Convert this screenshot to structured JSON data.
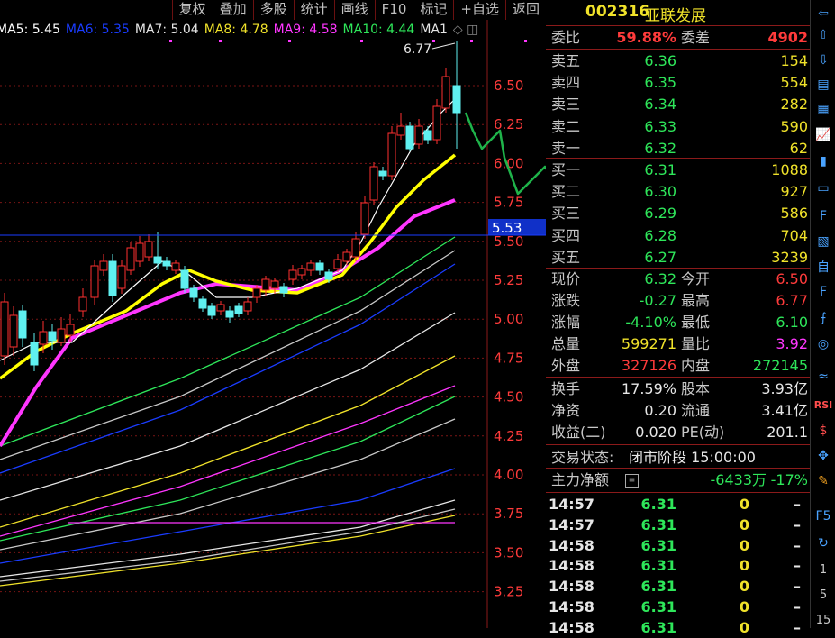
{
  "toolbar": [
    "复权",
    "叠加",
    "多股",
    "统计",
    "画线",
    "F10",
    "标记",
    "+自选",
    "返回"
  ],
  "ma_legend": [
    {
      "text": "MA5: 5.45",
      "color": "#ffffff"
    },
    {
      "text": "MA6: 5.35",
      "color": "#1a3cff"
    },
    {
      "text": "MA7: 5.04",
      "color": "#e6e6e6"
    },
    {
      "text": "MA8: 4.78",
      "color": "#f0e22a"
    },
    {
      "text": "MA9: 4.58",
      "color": "#ff36ff"
    },
    {
      "text": "MA10: 4.44",
      "color": "#2ee65a"
    },
    {
      "text": "MA1",
      "color": "#e6e6e6"
    }
  ],
  "chart": {
    "high_label": "6.77",
    "current_price_tag": "5.53",
    "y_ticks": [
      "6.50",
      "6.25",
      "6.00",
      "5.75",
      "5.50",
      "5.25",
      "5.00",
      "4.75",
      "4.50",
      "4.25",
      "4.00",
      "3.75",
      "3.50",
      "3.25"
    ],
    "y_tick_values": [
      6.5,
      6.25,
      6.0,
      5.75,
      5.5,
      5.25,
      5.0,
      4.75,
      4.5,
      4.25,
      4.0,
      3.75,
      3.5,
      3.25
    ]
  },
  "stock": {
    "code": "002316",
    "name": "亚联发展"
  },
  "weibi": {
    "label1": "委比",
    "value1": "59.88%",
    "label2": "委差",
    "value2": "4902"
  },
  "asks": [
    {
      "label": "卖五",
      "price": "6.36",
      "vol": "154"
    },
    {
      "label": "卖四",
      "price": "6.35",
      "vol": "554"
    },
    {
      "label": "卖三",
      "price": "6.34",
      "vol": "282"
    },
    {
      "label": "卖二",
      "price": "6.33",
      "vol": "590"
    },
    {
      "label": "卖一",
      "price": "6.32",
      "vol": "62"
    }
  ],
  "bids": [
    {
      "label": "买一",
      "price": "6.31",
      "vol": "1088"
    },
    {
      "label": "买二",
      "price": "6.30",
      "vol": "927"
    },
    {
      "label": "买三",
      "price": "6.29",
      "vol": "586"
    },
    {
      "label": "买四",
      "price": "6.28",
      "vol": "704"
    },
    {
      "label": "买五",
      "price": "6.27",
      "vol": "3239"
    }
  ],
  "quote": [
    {
      "l1": "现价",
      "v1": "6.32",
      "c1": "green",
      "l2": "今开",
      "v2": "6.50",
      "c2": "red"
    },
    {
      "l1": "涨跌",
      "v1": "-0.27",
      "c1": "green",
      "l2": "最高",
      "v2": "6.77",
      "c2": "red"
    },
    {
      "l1": "涨幅",
      "v1": "-4.10%",
      "c1": "green",
      "l2": "最低",
      "v2": "6.10",
      "c2": "green"
    },
    {
      "l1": "总量",
      "v1": "599271",
      "c1": "yellow",
      "l2": "量比",
      "v2": "3.92",
      "c2": "magenta"
    },
    {
      "l1": "外盘",
      "v1": "327126",
      "c1": "red",
      "l2": "内盘",
      "v2": "272145",
      "c2": "green"
    }
  ],
  "stats": [
    {
      "l1": "换手",
      "v1": "17.59%",
      "l2": "股本",
      "v2": "3.93亿"
    },
    {
      "l1": "净资",
      "v1": "0.20",
      "l2": "流通",
      "v2": "3.41亿"
    },
    {
      "l1": "收益(二)",
      "v1": "0.020",
      "l2": "PE(动)",
      "v2": "201.1"
    }
  ],
  "trade_status": {
    "label": "交易状态:",
    "value": "闭市阶段 15:00:00"
  },
  "main_fund": {
    "label": "主力净额",
    "amount": "-6433万",
    "pct": "-17%"
  },
  "ticks": [
    {
      "time": "14:57",
      "price": "6.31",
      "vol": "0",
      "dir": "–"
    },
    {
      "time": "14:57",
      "price": "6.31",
      "vol": "0",
      "dir": "–"
    },
    {
      "time": "14:58",
      "price": "6.31",
      "vol": "0",
      "dir": "–"
    },
    {
      "time": "14:58",
      "price": "6.31",
      "vol": "0",
      "dir": "–"
    },
    {
      "time": "14:58",
      "price": "6.31",
      "vol": "0",
      "dir": "–"
    },
    {
      "time": "14:58",
      "price": "6.31",
      "vol": "0",
      "dir": "–"
    },
    {
      "time": "14:58",
      "price": "6.31",
      "vol": "0",
      "dir": "–"
    }
  ],
  "sidebar_icons": [
    "arrow-left-icon",
    "arrow-up-icon",
    "arrow-down-icon",
    "list-icon",
    "grid-icon",
    "line-chart-icon",
    "candlestick-icon",
    "board-icon",
    "f10-icon",
    "f6-icon",
    "f7-icon",
    "f12-icon",
    "fx-icon",
    "circle-icon",
    "volume-icon",
    "rsi-icon",
    "dollar-icon",
    "move-icon",
    "pencil-icon",
    "f5-icon",
    "refresh-icon"
  ],
  "sidebar_labels": [
    "RSI",
    "1",
    "5",
    "15"
  ]
}
